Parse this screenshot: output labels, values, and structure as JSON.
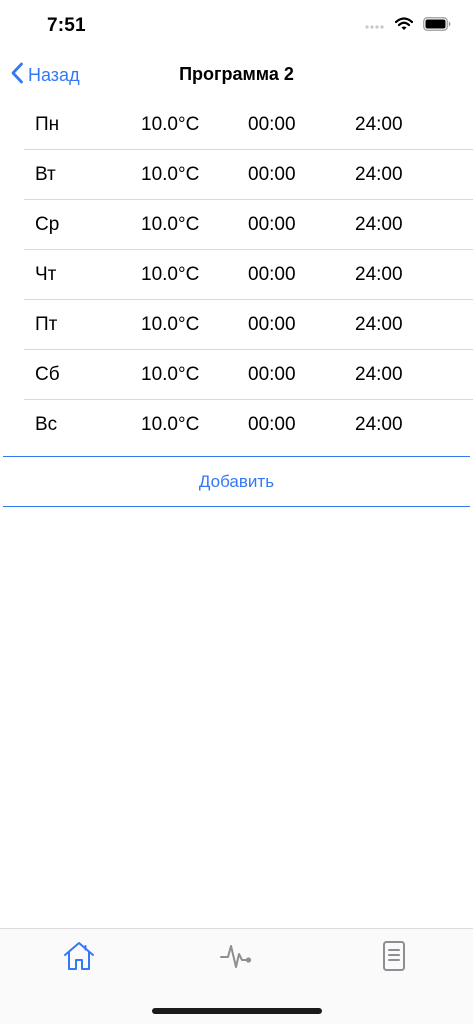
{
  "status_bar": {
    "time": "7:51"
  },
  "nav": {
    "back_label": "Назад",
    "title": "Программа 2"
  },
  "schedule": {
    "rows": [
      {
        "day": "Пн",
        "temp": "10.0°C",
        "start": "00:00",
        "end": "24:00"
      },
      {
        "day": "Вт",
        "temp": "10.0°C",
        "start": "00:00",
        "end": "24:00"
      },
      {
        "day": "Ср",
        "temp": "10.0°C",
        "start": "00:00",
        "end": "24:00"
      },
      {
        "day": "Чт",
        "temp": "10.0°C",
        "start": "00:00",
        "end": "24:00"
      },
      {
        "day": "Пт",
        "temp": "10.0°C",
        "start": "00:00",
        "end": "24:00"
      },
      {
        "day": "Сб",
        "temp": "10.0°C",
        "start": "00:00",
        "end": "24:00"
      },
      {
        "day": "Вс",
        "temp": "10.0°C",
        "start": "00:00",
        "end": "24:00"
      }
    ]
  },
  "add_button_label": "Добавить",
  "tab_bar": {
    "tabs": [
      {
        "icon": "home-icon",
        "active": true
      },
      {
        "icon": "activity-icon",
        "active": false
      },
      {
        "icon": "document-icon",
        "active": false
      }
    ]
  },
  "colors": {
    "accent": "#3478f6",
    "inactive_icon": "#8e8e93",
    "divider": "#d9d9dc"
  }
}
